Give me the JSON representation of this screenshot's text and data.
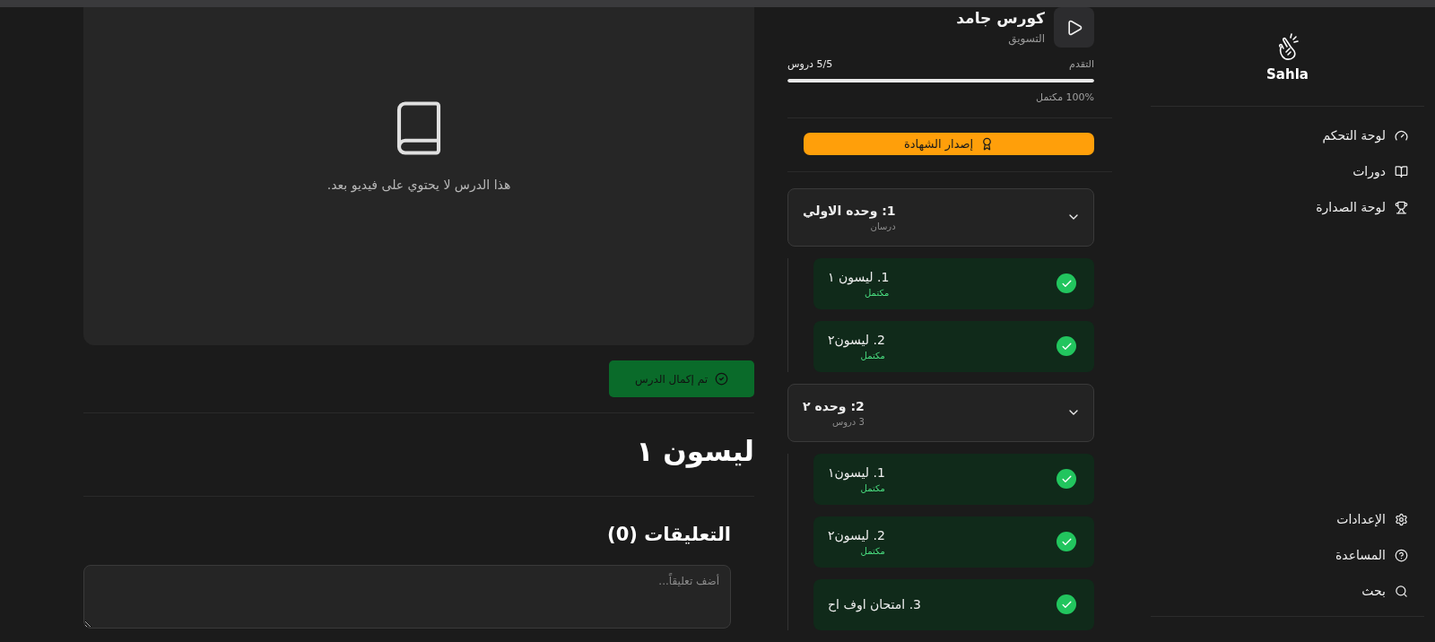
{
  "sidebar": {
    "brand": "Sahla",
    "nav": [
      {
        "label": "لوحة التحكم"
      },
      {
        "label": "دورات"
      },
      {
        "label": "لوحة الصدارة"
      }
    ],
    "bottom": [
      {
        "label": "الإعدادات"
      },
      {
        "label": "المساعدة"
      },
      {
        "label": "بحث"
      }
    ]
  },
  "course": {
    "title": "كورس جامد",
    "category": "التسويق",
    "progress_label": "التقدم",
    "lesson_count": "5/5 دروس",
    "level": 1,
    "percent": "100% مكتمل",
    "certificate_button": "إصدار الشهادة",
    "units": [
      {
        "title": "1: وحده الاولي",
        "subtitle": "درسان",
        "expanded": true,
        "lessons": [
          {
            "title": "1. ليسون ١",
            "status": "مكتمل",
            "completed": true
          },
          {
            "title": "2. ليسون٢",
            "status": "مكتمل",
            "completed": true
          }
        ]
      },
      {
        "title": "2: وحده ٢",
        "subtitle": "3 دروس",
        "expanded": true,
        "lessons": [
          {
            "title": "1. ليسون١",
            "status": "مكتمل",
            "completed": true
          },
          {
            "title": "2. ليسون٢",
            "status": "مكتمل",
            "completed": true
          },
          {
            "title": "3. امتحان اوف اح",
            "completed": true
          }
        ]
      }
    ]
  },
  "lesson": {
    "video_message": "هذا الدرس لا يحتوي على فيديو بعد.",
    "complete_button": "تم إكمال الدرس",
    "title": "ليسون ١",
    "comments_heading": "التعليقات (0)",
    "comment_placeholder": "أضف تعليقاً..."
  }
}
